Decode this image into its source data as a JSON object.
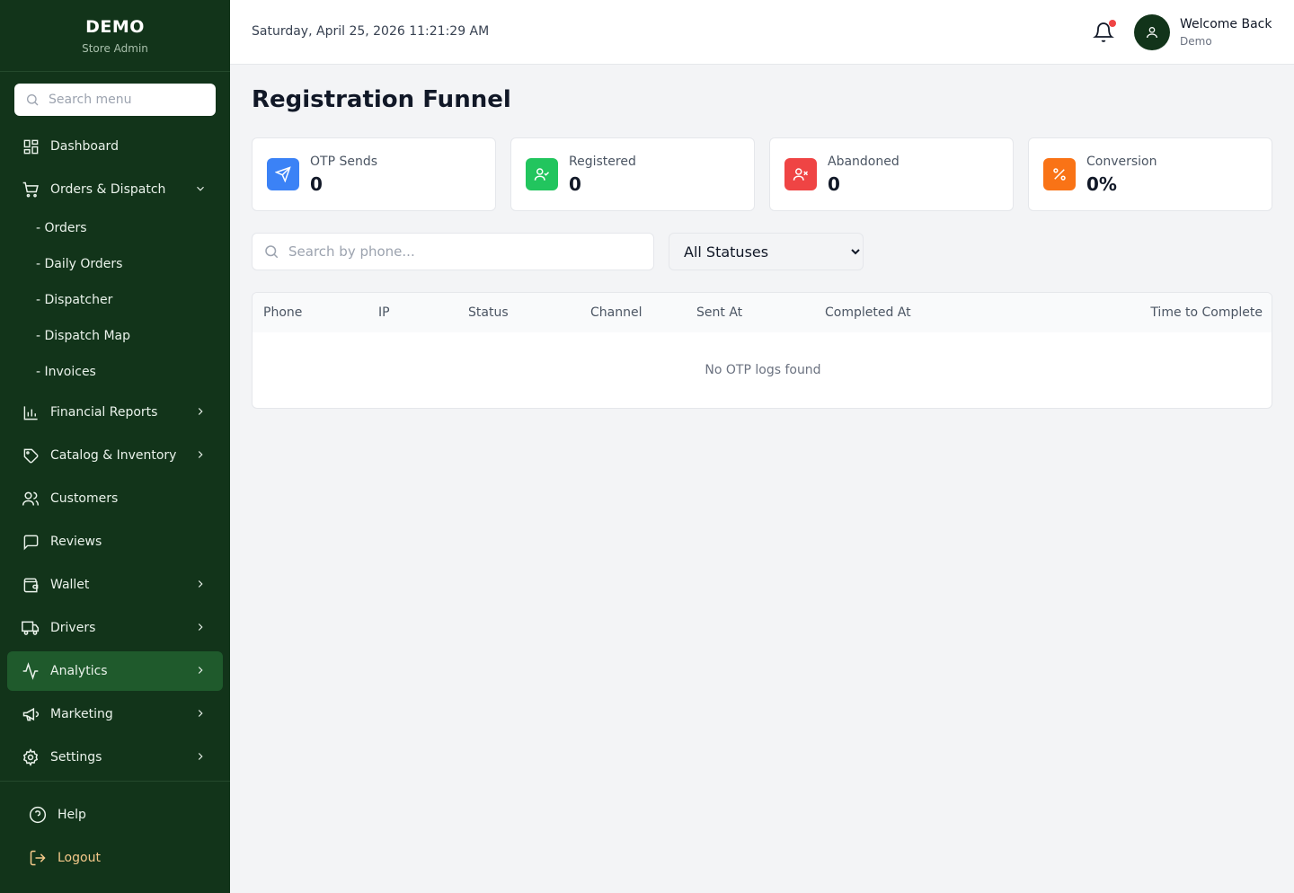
{
  "brand": {
    "title": "DEMO",
    "subtitle": "Store Admin"
  },
  "sidebar": {
    "search_placeholder": "Search menu",
    "items": [
      {
        "label": "Dashboard"
      },
      {
        "label": "Orders & Dispatch"
      },
      {
        "label": "Financial Reports"
      },
      {
        "label": "Catalog & Inventory"
      },
      {
        "label": "Customers"
      },
      {
        "label": "Reviews"
      },
      {
        "label": "Wallet"
      },
      {
        "label": "Drivers"
      },
      {
        "label": "Analytics",
        "active": true
      },
      {
        "label": "Marketing"
      },
      {
        "label": "Settings"
      }
    ],
    "subitems": [
      "- Orders",
      "- Daily Orders",
      "- Dispatcher",
      "- Dispatch Map",
      "- Invoices"
    ],
    "footer": {
      "help": "Help",
      "logout": "Logout"
    }
  },
  "header": {
    "datetime": "Saturday, April 25, 2026 11:21:29 AM",
    "welcome": "Welcome Back",
    "user": "Demo"
  },
  "page": {
    "title": "Registration Funnel"
  },
  "stats": [
    {
      "label": "OTP Sends",
      "value": "0",
      "color": "#3b82f6",
      "icon": "send-icon"
    },
    {
      "label": "Registered",
      "value": "0",
      "color": "#22c55e",
      "icon": "user-check-icon"
    },
    {
      "label": "Abandoned",
      "value": "0",
      "color": "#ef4444",
      "icon": "user-x-icon"
    },
    {
      "label": "Conversion",
      "value": "0%",
      "color": "#f97316",
      "icon": "percent-icon"
    }
  ],
  "filters": {
    "phone_placeholder": "Search by phone...",
    "status_selected": "All Statuses"
  },
  "table": {
    "columns": [
      "Phone",
      "IP",
      "Status",
      "Channel",
      "Sent At",
      "Completed At",
      "Time to Complete"
    ],
    "empty_text": "No OTP logs found"
  },
  "colors": {
    "sidebar_bg": "#12341a",
    "active_bg": "#1f5a2c",
    "logout": "#f5c98a"
  }
}
